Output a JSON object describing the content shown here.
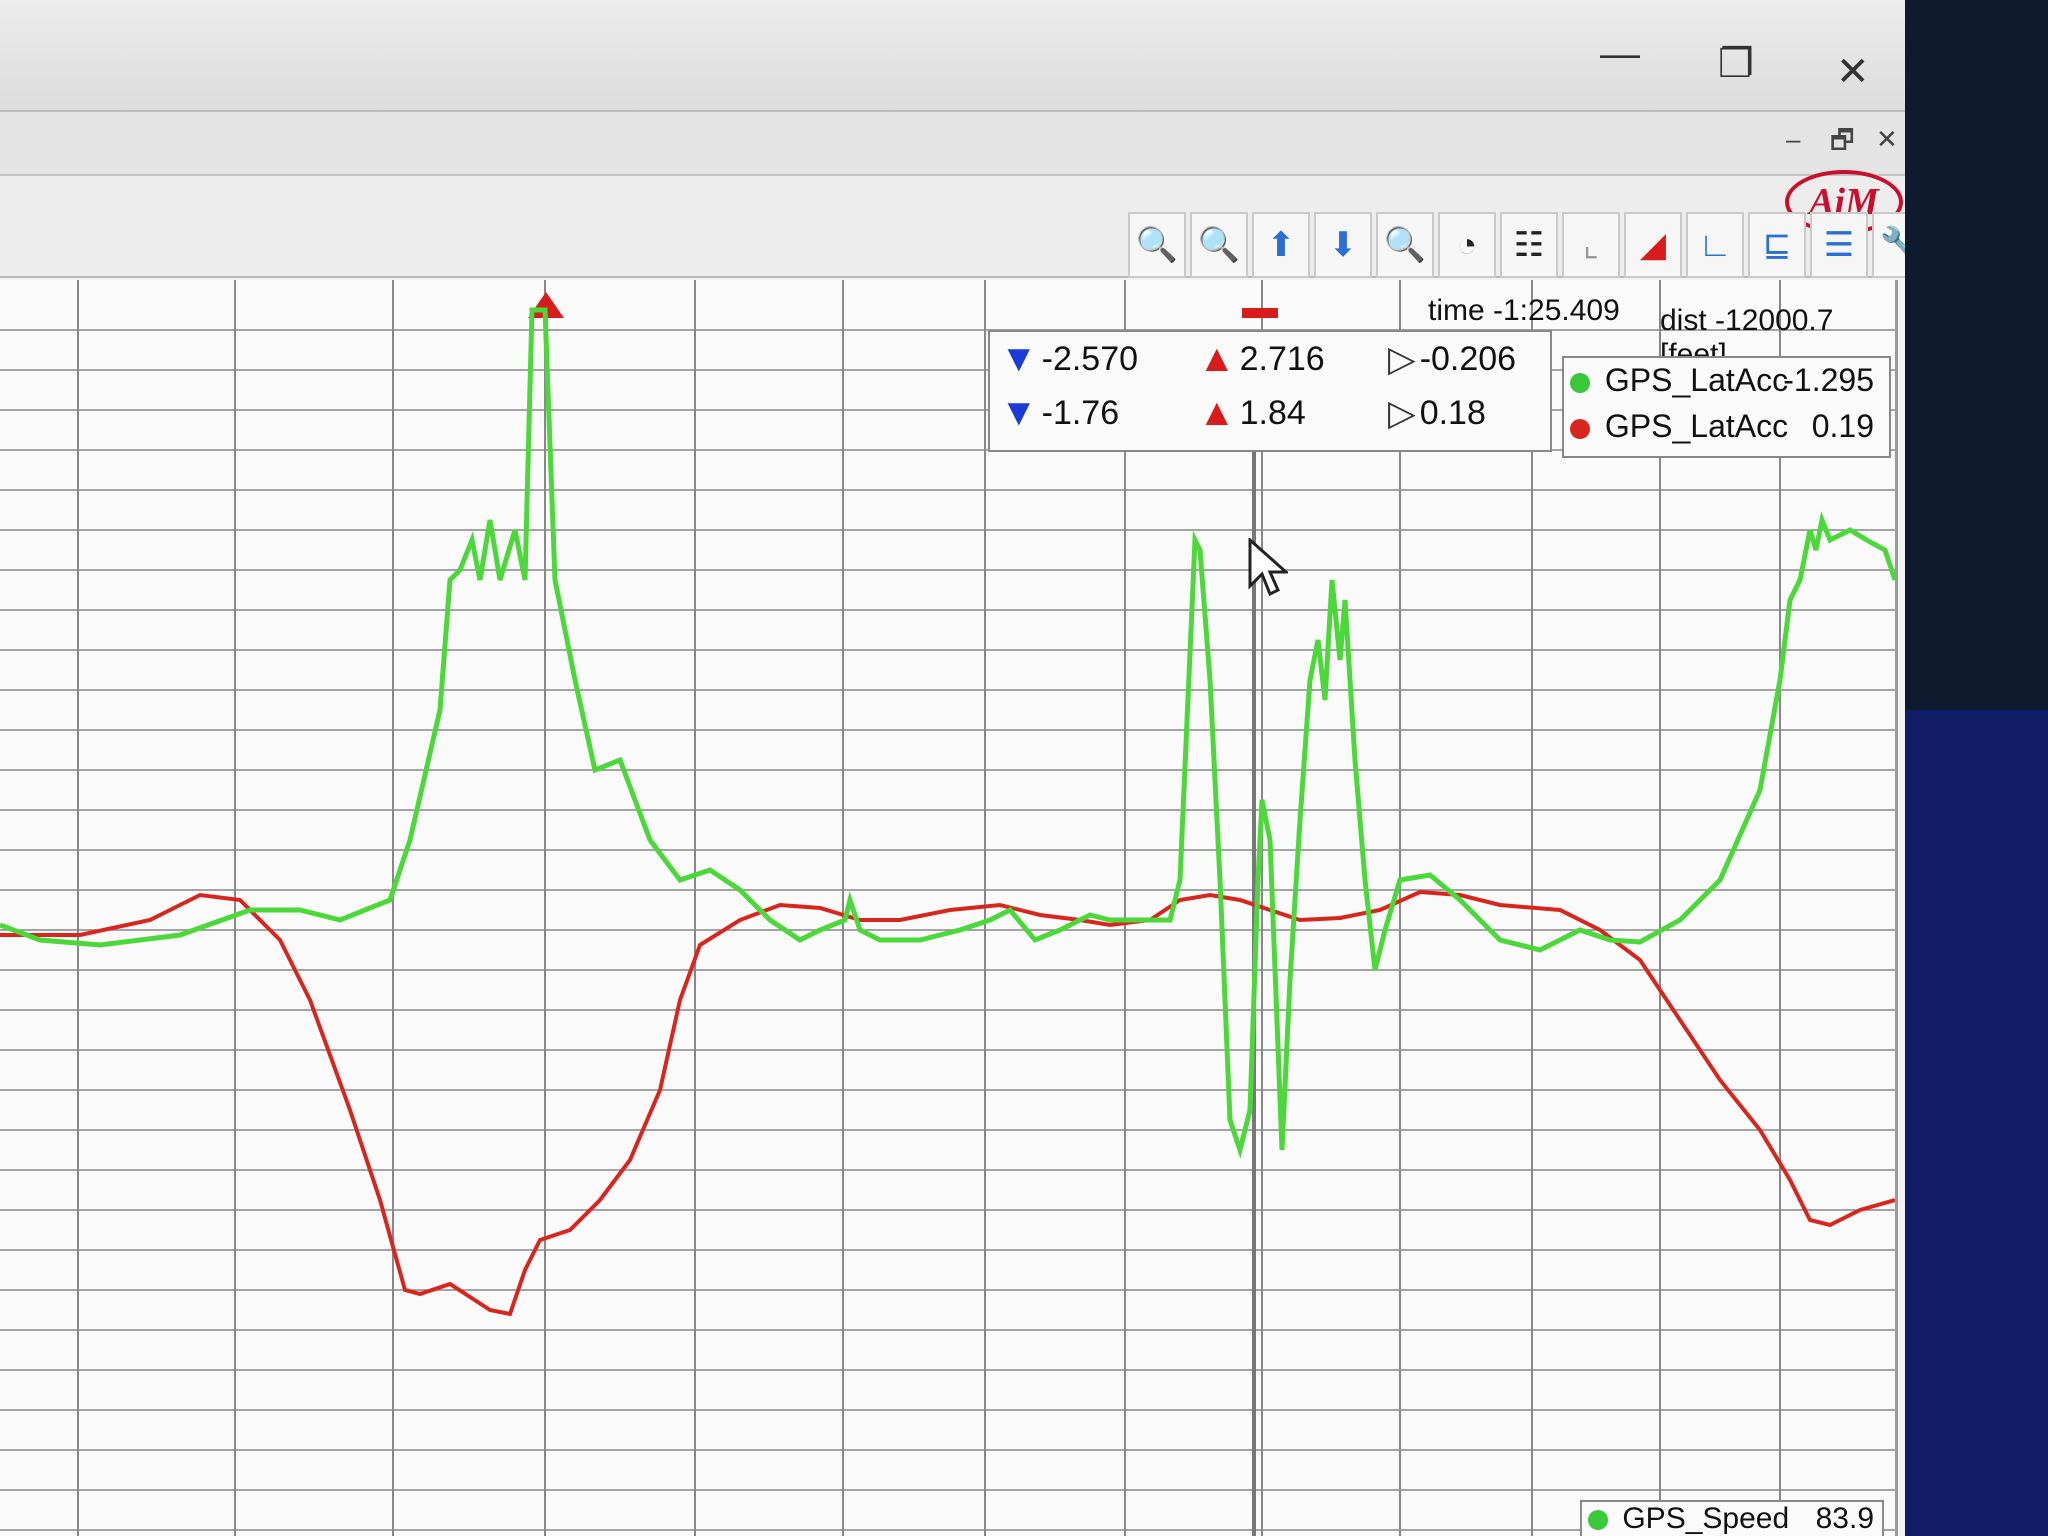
{
  "window": {
    "minimize_glyph": "—",
    "restore_glyph": "❐",
    "close_glyph": "✕"
  },
  "inner_window": {
    "minimize_glyph": "–",
    "restore_glyph": "🗗",
    "close_glyph": "✕"
  },
  "logo": {
    "text": "AiM"
  },
  "toolbar": {
    "icons": [
      "zoom-reset-icon",
      "zoom-in-icon",
      "pan-up-icon",
      "pan-down-icon",
      "zoom-out-icon",
      "clock-icon",
      "grid-options-icon",
      "measure-icon",
      "red-marker-icon",
      "axis-l-icon",
      "axis-split-icon",
      "axis-stack-icon",
      "wrench-icon"
    ]
  },
  "status": {
    "time_label": "time -1:25.409",
    "dist_label": "dist -12000.7 [feet]"
  },
  "measures": {
    "row1": {
      "min": "-2.570",
      "max": "2.716",
      "delta": "-0.206"
    },
    "row2": {
      "min": "-1.76",
      "max": "1.84",
      "delta": "0.18"
    }
  },
  "legend": [
    {
      "name": "GPS_LatAcc",
      "value": "-1.295",
      "color": "#39c93a"
    },
    {
      "name": "GPS_LatAcc",
      "value": "0.19",
      "color": "#d8261e"
    }
  ],
  "speed_legend": {
    "name": "GPS_Speed",
    "value": "83.9",
    "color": "#39c93a"
  },
  "colors": {
    "green_trace": "#4cd83a",
    "red_trace": "#d8261e",
    "grid": "#8a8a8a",
    "plot_bg": "#fafafa"
  }
}
